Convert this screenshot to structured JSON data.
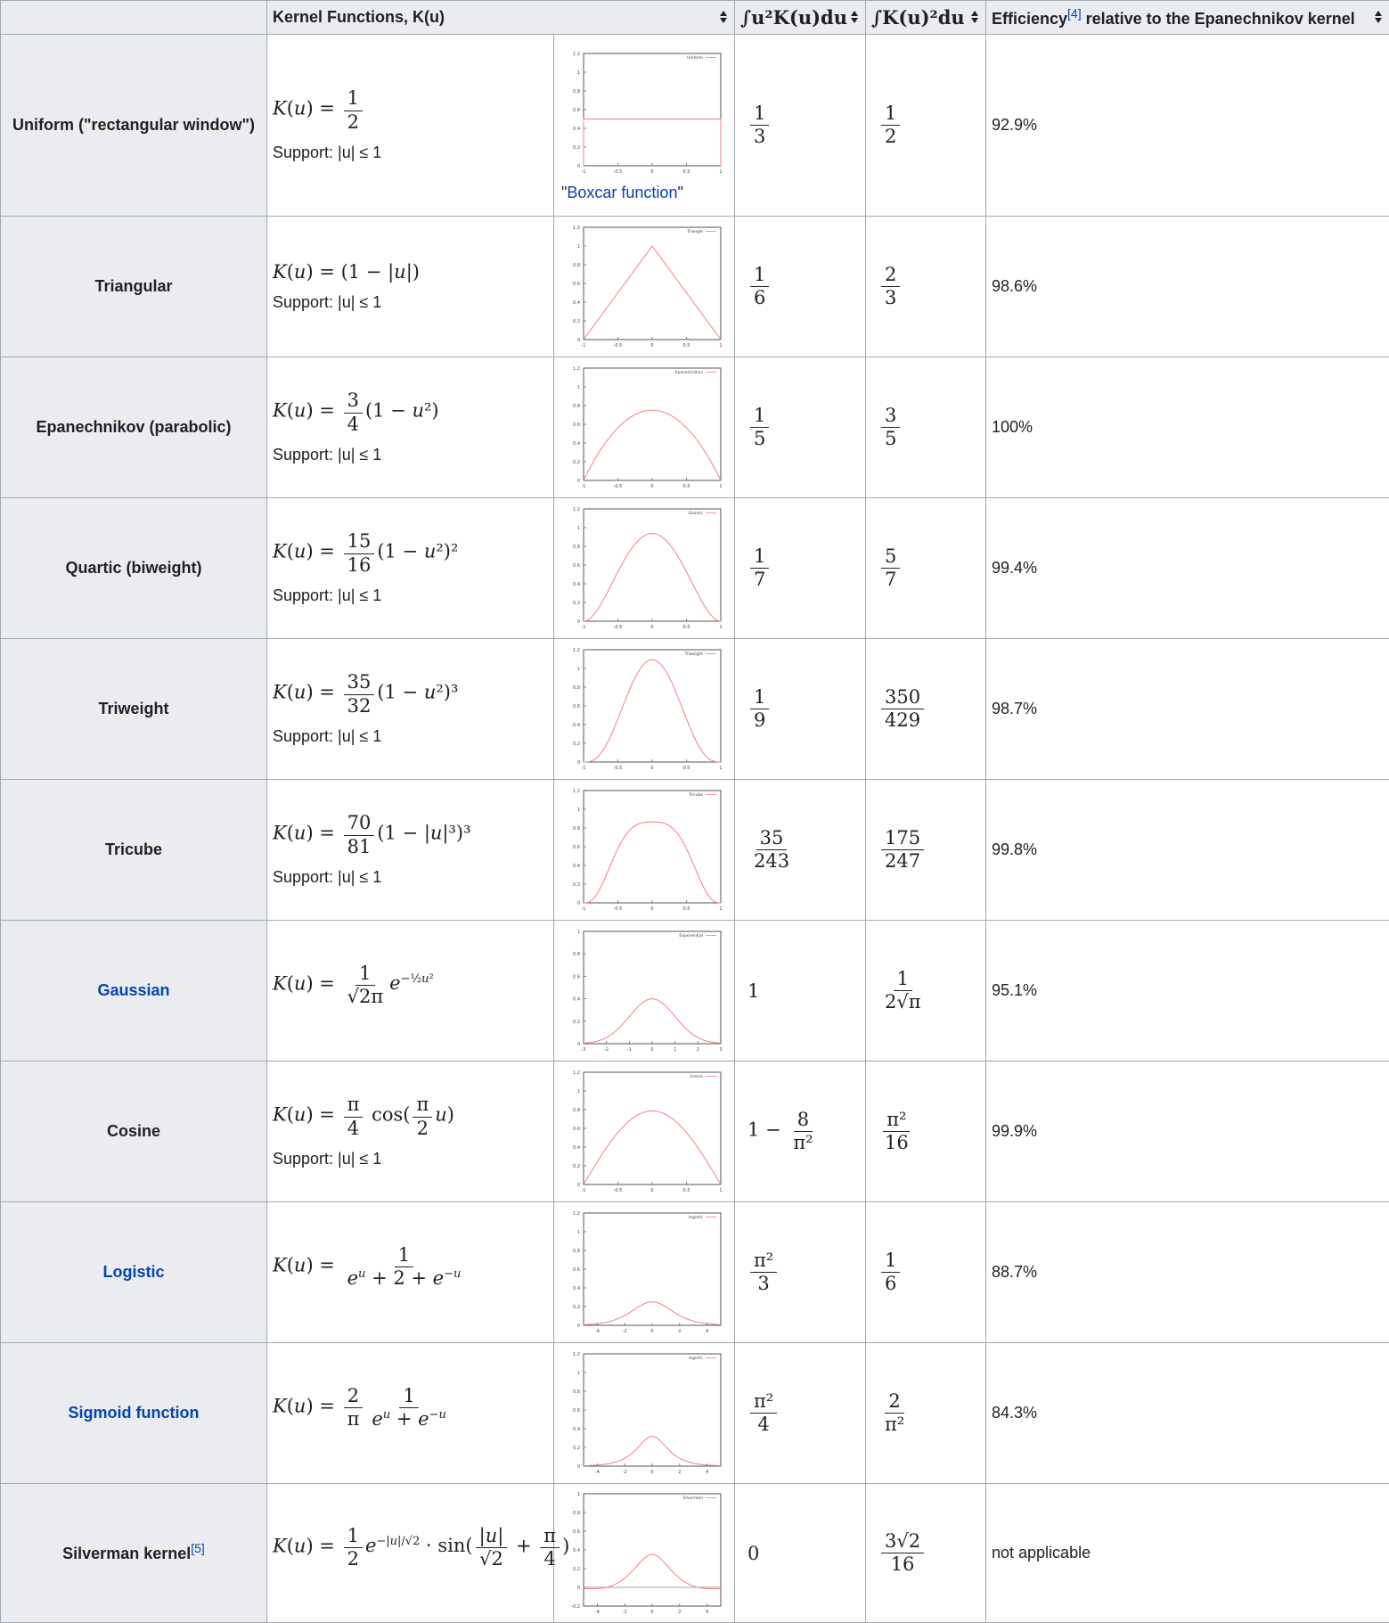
{
  "header": {
    "col_kernel": "Kernel Functions, K(u)",
    "col_moment": "∫u²K(u)du",
    "col_norm": "∫K(u)²du",
    "col_eff_prefix": "Efficiency",
    "col_eff_ref": "[4]",
    "col_eff_suffix": "relative to the Epanechnikov kernel"
  },
  "support_label": "Support: |u| ≤ 1",
  "rows": [
    {
      "name": "Uniform (\"rectangular window\")",
      "name_link": false,
      "formula": "K(u) = 1/2",
      "support": true,
      "plot_label": "Uniform",
      "caption": "Boxcar function",
      "moment": "1/3",
      "norm": "1/2",
      "efficiency": "92.9%"
    },
    {
      "name": "Triangular",
      "name_link": false,
      "formula": "K(u) = (1 − |u|)",
      "support": true,
      "plot_label": "Triangle",
      "moment": "1/6",
      "norm": "2/3",
      "efficiency": "98.6%"
    },
    {
      "name": "Epanechnikov (parabolic)",
      "name_link": false,
      "formula": "K(u) = 3/4 (1 − u²)",
      "support": true,
      "plot_label": "Epanechnikov",
      "moment": "1/5",
      "norm": "3/5",
      "efficiency": "100%"
    },
    {
      "name": "Quartic (biweight)",
      "name_link": false,
      "formula": "K(u) = 15/16 (1 − u²)²",
      "support": true,
      "plot_label": "Quartic",
      "moment": "1/7",
      "norm": "5/7",
      "efficiency": "99.4%"
    },
    {
      "name": "Triweight",
      "name_link": false,
      "formula": "K(u) = 35/32 (1 − u²)³",
      "support": true,
      "plot_label": "Triweight",
      "moment": "1/9",
      "norm": "350/429",
      "efficiency": "98.7%"
    },
    {
      "name": "Tricube",
      "name_link": false,
      "formula": "K(u) = 70/81 (1 − |u|³)³",
      "support": true,
      "plot_label": "Tricube",
      "moment": "35/243",
      "norm": "175/247",
      "efficiency": "99.8%"
    },
    {
      "name": "Gaussian",
      "name_link": true,
      "formula": "K(u) = 1/√(2π) e^(−½u²)",
      "support": false,
      "plot_label": "Exponential",
      "moment": "1",
      "norm": "1/(2√π)",
      "efficiency": "95.1%"
    },
    {
      "name": "Cosine",
      "name_link": false,
      "formula": "K(u) = π/4 cos(π/2 u)",
      "support": true,
      "plot_label": "Cosine",
      "moment": "1 − 8/π²",
      "norm": "π²/16",
      "efficiency": "99.9%"
    },
    {
      "name": "Logistic",
      "name_link": true,
      "formula": "K(u) = 1/(e^u + 2 + e^−u)",
      "support": false,
      "plot_label": "logistic",
      "moment": "π²/3",
      "norm": "1/6",
      "efficiency": "88.7%"
    },
    {
      "name": "Sigmoid function",
      "name_link": true,
      "formula": "K(u) = 2/π · 1/(e^u + e^−u)",
      "support": false,
      "plot_label": "logistic",
      "moment": "π²/4",
      "norm": "2/π²",
      "efficiency": "84.3%"
    },
    {
      "name": "Silverman kernel",
      "name_ref": "[5]",
      "name_link": false,
      "formula": "K(u) = 1/2 e^(−|u|/√2) · sin(|u|/√2 + π/4)",
      "support": false,
      "plot_label": "Silverman",
      "moment": "0",
      "norm": "3√2/16",
      "efficiency": "not applicable"
    }
  ],
  "chart_data": [
    {
      "type": "line",
      "kernel": "uniform",
      "legend": "Uniform",
      "xlim": [
        -1,
        1
      ],
      "ylim": [
        0,
        1.2
      ],
      "xticks": [
        "-1",
        "-0.5",
        "0",
        "0.5",
        "1"
      ],
      "yticks": [
        "0",
        "0.2",
        "0.4",
        "0.6",
        "0.8",
        "1",
        "1.2"
      ]
    },
    {
      "type": "line",
      "kernel": "triangular",
      "legend": "Triangle",
      "xlim": [
        -1,
        1
      ],
      "ylim": [
        0,
        1.2
      ],
      "xticks": [
        "-1",
        "-0.5",
        "0",
        "0.5",
        "1"
      ],
      "yticks": [
        "0",
        "0.2",
        "0.4",
        "0.6",
        "0.8",
        "1",
        "1.2"
      ]
    },
    {
      "type": "line",
      "kernel": "epanechnikov",
      "legend": "Epanechnikov",
      "xlim": [
        -1,
        1
      ],
      "ylim": [
        0,
        1.2
      ],
      "xticks": [
        "-1",
        "-0.5",
        "0",
        "0.5",
        "1"
      ],
      "yticks": [
        "0",
        "0.2",
        "0.4",
        "0.6",
        "0.8",
        "1",
        "1.2"
      ]
    },
    {
      "type": "line",
      "kernel": "quartic",
      "legend": "Quartic",
      "xlim": [
        -1,
        1
      ],
      "ylim": [
        0,
        1.2
      ],
      "xticks": [
        "-1",
        "-0.5",
        "0",
        "0.5",
        "1"
      ],
      "yticks": [
        "0",
        "0.2",
        "0.4",
        "0.6",
        "0.8",
        "1",
        "1.2"
      ]
    },
    {
      "type": "line",
      "kernel": "triweight",
      "legend": "Triweight",
      "xlim": [
        -1,
        1
      ],
      "ylim": [
        0,
        1.2
      ],
      "xticks": [
        "-1",
        "-0.5",
        "0",
        "0.5",
        "1"
      ],
      "yticks": [
        "0",
        "0.2",
        "0.4",
        "0.6",
        "0.8",
        "1",
        "1.2"
      ]
    },
    {
      "type": "line",
      "kernel": "tricube",
      "legend": "Tricube",
      "xlim": [
        -1,
        1
      ],
      "ylim": [
        0,
        1.2
      ],
      "xticks": [
        "-1",
        "-0.5",
        "0",
        "0.5",
        "1"
      ],
      "yticks": [
        "0",
        "0.2",
        "0.4",
        "0.6",
        "0.8",
        "1",
        "1.2"
      ]
    },
    {
      "type": "line",
      "kernel": "gaussian",
      "legend": "Exponential",
      "xlim": [
        -3,
        3
      ],
      "ylim": [
        0,
        1
      ],
      "xticks": [
        "-3",
        "-2",
        "-1",
        "0",
        "1",
        "2",
        "3"
      ],
      "yticks": [
        "0",
        "0.2",
        "0.4",
        "0.6",
        "0.8",
        "1"
      ]
    },
    {
      "type": "line",
      "kernel": "cosine",
      "legend": "Cosine",
      "xlim": [
        -1,
        1
      ],
      "ylim": [
        0,
        1.2
      ],
      "xticks": [
        "-1",
        "-0.5",
        "0",
        "0.5",
        "1"
      ],
      "yticks": [
        "0",
        "0.2",
        "0.4",
        "0.6",
        "0.8",
        "1",
        "1.2"
      ]
    },
    {
      "type": "line",
      "kernel": "logistic",
      "legend": "logistic",
      "xlim": [
        -5,
        5
      ],
      "ylim": [
        0,
        1.2
      ],
      "xticks": [
        "-4",
        "-2",
        "0",
        "2",
        "4"
      ],
      "yticks": [
        "0",
        "0.2",
        "0.4",
        "0.6",
        "0.8",
        "1",
        "1.2"
      ]
    },
    {
      "type": "line",
      "kernel": "sigmoid",
      "legend": "logistic",
      "xlim": [
        -5,
        5
      ],
      "ylim": [
        0,
        1.2
      ],
      "xticks": [
        "-4",
        "-2",
        "0",
        "2",
        "4"
      ],
      "yticks": [
        "0",
        "0.2",
        "0.4",
        "0.6",
        "0.8",
        "1",
        "1.2"
      ]
    },
    {
      "type": "line",
      "kernel": "silverman",
      "legend": "Silverman",
      "xlim": [
        -5,
        5
      ],
      "ylim": [
        -0.2,
        1
      ],
      "xticks": [
        "-4",
        "-2",
        "0",
        "2",
        "4"
      ],
      "yticks": [
        "-0.2",
        "0",
        "0.2",
        "0.4",
        "0.6",
        "0.8",
        "1"
      ]
    }
  ]
}
